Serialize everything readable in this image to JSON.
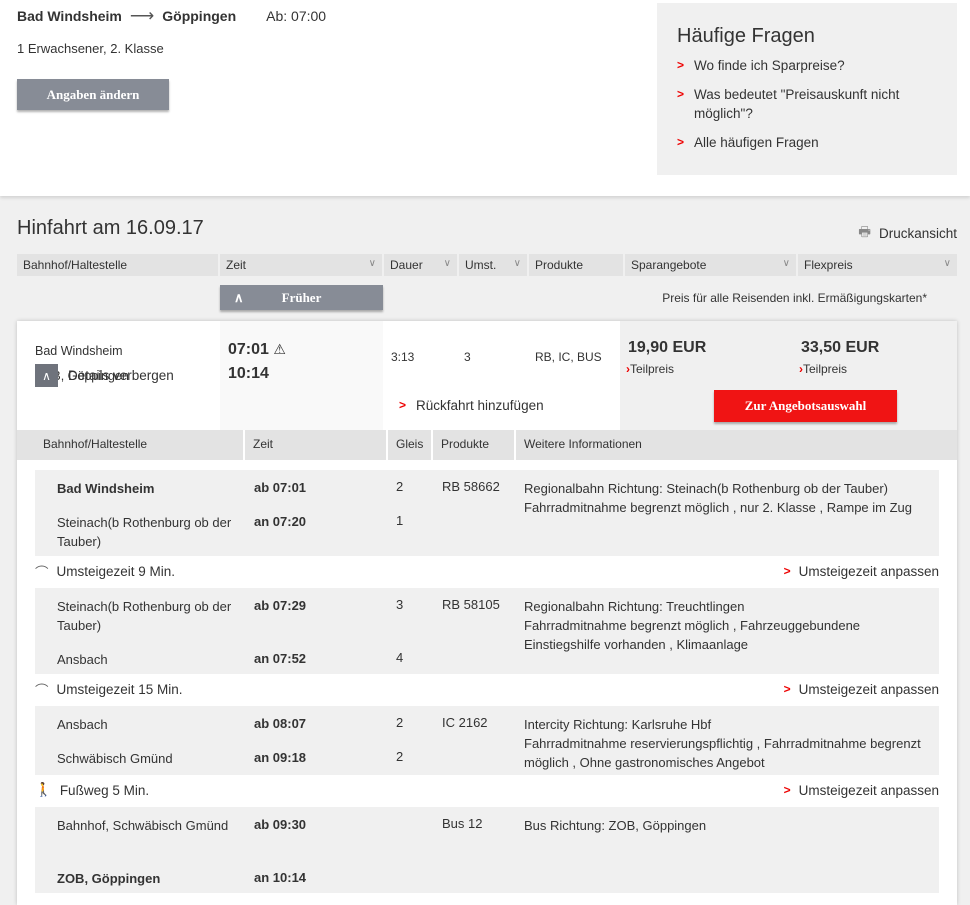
{
  "search": {
    "from": "Bad Windsheim",
    "to": "Göppingen",
    "departure": "Ab: 07:00",
    "passengers": "1 Erwachsener, 2. Klasse",
    "change_label": "Angaben ändern"
  },
  "faq": {
    "title": "Häufige Fragen",
    "items": [
      "Wo finde ich Sparpreise?",
      "Was bedeutet \"Preisauskunft nicht möglich\"?",
      "Alle häufigen Fragen"
    ]
  },
  "results": {
    "title": "Hinfahrt am 16.09.17",
    "print_label": "Druckansicht",
    "columns": [
      "Bahnhof/Haltestelle",
      "Zeit",
      "Dauer",
      "Umst.",
      "Produkte",
      "Sparangebote",
      "Flexpreis"
    ],
    "earlier_label": "Früher",
    "price_note": "Preis für alle Reisenden inkl. Ermäßigungskarten*"
  },
  "connection": {
    "from": "Bad Windsheim",
    "to": "ZOB, Göppingen",
    "dep": "07:01",
    "arr": "10:14",
    "duration": "3:13",
    "changes": "3",
    "products": "RB, IC, BUS",
    "spar_price": "19,90 EUR",
    "flex_price": "33,50 EUR",
    "teilpreis": "Teilpreis",
    "details_label": "Details verbergen",
    "return_label": "Rückfahrt hinzufügen",
    "select_label": "Zur Angebotsauswahl"
  },
  "details": {
    "columns": [
      "Bahnhof/Haltestelle",
      "Zeit",
      "Gleis",
      "Produkte",
      "Weitere Informationen"
    ],
    "segments": [
      {
        "dep_station": "Bad Windsheim",
        "dep_time": "ab 07:01",
        "dep_track": "2",
        "arr_station": "Steinach(b Rothenburg ob der Tauber)",
        "arr_time": "an 07:20",
        "arr_track": "1",
        "product": "RB 58662",
        "info1": "Regionalbahn Richtung: Steinach(b Rothenburg ob der Tauber)",
        "info2": "Fahrradmitnahme begrenzt möglich , nur 2. Klasse , Rampe im Zug"
      },
      {
        "dep_station": "Steinach(b Rothenburg ob der Tauber)",
        "dep_time": "ab 07:29",
        "dep_track": "3",
        "arr_station": "Ansbach",
        "arr_time": "an 07:52",
        "arr_track": "4",
        "product": "RB 58105",
        "info1": "Regionalbahn Richtung: Treuchtlingen",
        "info2": "Fahrradmitnahme begrenzt möglich , Fahrzeuggebundene Einstiegshilfe vorhanden , Klimaanlage"
      },
      {
        "dep_station": "Ansbach",
        "dep_time": "ab 08:07",
        "dep_track": "2",
        "arr_station": "Schwäbisch Gmünd",
        "arr_time": "an 09:18",
        "arr_track": "2",
        "product": "IC 2162",
        "info1": "Intercity Richtung: Karlsruhe Hbf",
        "info2": "Fahrradmitnahme reservierungspflichtig , Fahrradmitnahme begrenzt möglich , Ohne gastronomisches Angebot"
      },
      {
        "dep_station": "Bahnhof, Schwäbisch Gmünd",
        "dep_time": "ab 09:30",
        "dep_track": "",
        "arr_station": "ZOB, Göppingen",
        "arr_time": "an 10:14",
        "arr_track": "",
        "product": "Bus 12",
        "info1": "Bus Richtung: ZOB, Göppingen",
        "info2": ""
      }
    ],
    "transfers": [
      {
        "label": "Umsteigezeit 9 Min.",
        "action": "Umsteigezeit anpassen"
      },
      {
        "label": "Umsteigezeit 15 Min.",
        "action": "Umsteigezeit anpassen"
      },
      {
        "label": "Fußweg 5 Min.",
        "action": "Umsteigezeit anpassen"
      }
    ]
  }
}
